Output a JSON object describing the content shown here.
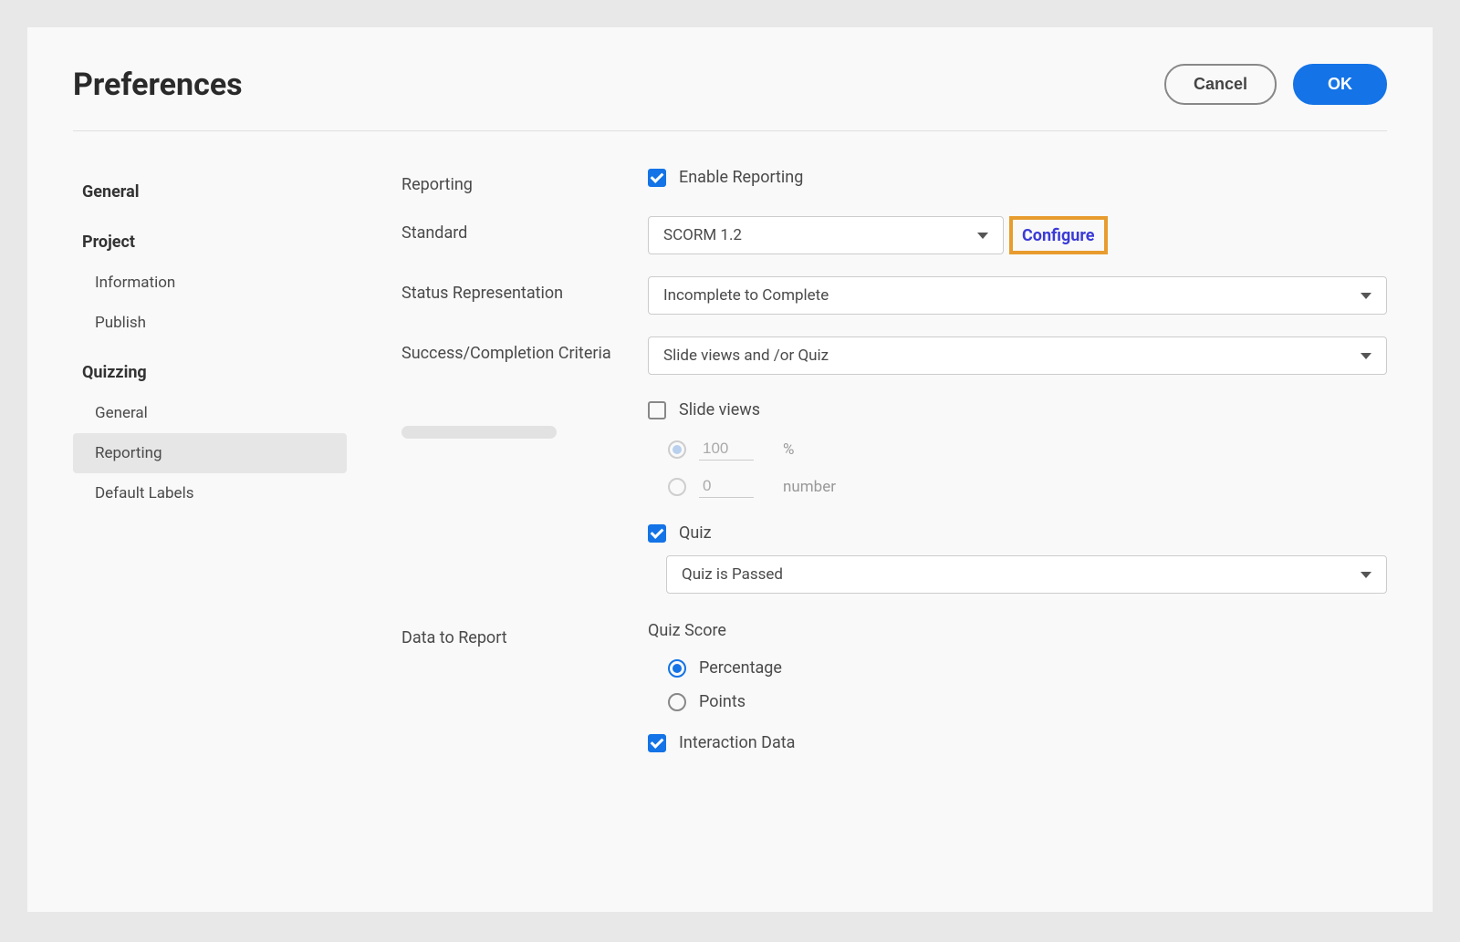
{
  "dialog": {
    "title": "Preferences",
    "buttons": {
      "cancel": "Cancel",
      "ok": "OK"
    }
  },
  "sidebar": {
    "groups": [
      {
        "title": "General",
        "items": []
      },
      {
        "title": "Project",
        "items": [
          {
            "label": "Information",
            "key": "information"
          },
          {
            "label": "Publish",
            "key": "publish"
          }
        ]
      },
      {
        "title": "Quizzing",
        "items": [
          {
            "label": "General",
            "key": "q-general"
          },
          {
            "label": "Reporting",
            "key": "reporting",
            "active": true
          },
          {
            "label": "Default Labels",
            "key": "default-labels"
          }
        ]
      }
    ]
  },
  "main": {
    "reporting": {
      "label": "Reporting",
      "enable_label": "Enable Reporting",
      "enable_checked": true
    },
    "standard": {
      "label": "Standard",
      "value": "SCORM 1.2",
      "configure": "Configure"
    },
    "status_rep": {
      "label": "Status Representation",
      "value": "Incomplete to Complete"
    },
    "criteria": {
      "label": "Success/Completion Criteria",
      "value": "Slide views and /or Quiz"
    },
    "slide_views": {
      "label": "Slide views",
      "checked": false,
      "percent_value": "100",
      "percent_unit": "%",
      "number_value": "0",
      "number_unit": "number"
    },
    "quiz": {
      "label": "Quiz",
      "checked": true,
      "condition_value": "Quiz is Passed"
    },
    "data_report": {
      "label": "Data to Report",
      "quiz_score_heading": "Quiz Score",
      "percentage_label": "Percentage",
      "points_label": "Points",
      "interaction_label": "Interaction Data",
      "interaction_checked": true
    }
  }
}
